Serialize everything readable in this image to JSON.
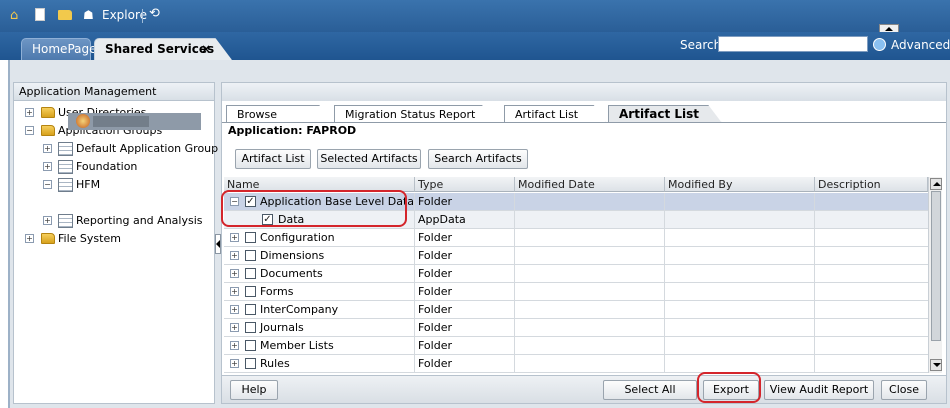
{
  "topbar": {
    "explore_label": "Explore"
  },
  "tabs": [
    {
      "label": "HomePage"
    },
    {
      "label": "Shared Services",
      "close": "×"
    }
  ],
  "search": {
    "label": "Search",
    "value": "",
    "advanced_label": "Advanced"
  },
  "left_panel": {
    "title": "Application Management",
    "tree": [
      {
        "label": "User Directories",
        "expander": "+"
      },
      {
        "label": "Application Groups",
        "expander": "−"
      },
      {
        "label": "Default Application Group",
        "expander": "+"
      },
      {
        "label": "Foundation",
        "expander": "+"
      },
      {
        "label": "HFM",
        "expander": "−"
      },
      {
        "label": "Reporting and Analysis",
        "expander": "+"
      },
      {
        "label": "File System",
        "expander": "+"
      }
    ]
  },
  "sub_tabs": [
    {
      "label": "Browse"
    },
    {
      "label": "Migration Status Report"
    },
    {
      "label": "Artifact List"
    },
    {
      "label": "Artifact List"
    }
  ],
  "application": {
    "label": "Application:",
    "name": "FAPROD"
  },
  "action_buttons": {
    "artifact_list": "Artifact List",
    "selected_artifacts": "Selected Artifacts",
    "search_artifacts": "Search Artifacts"
  },
  "grid": {
    "columns": [
      "Name",
      "Type",
      "Modified Date",
      "Modified By",
      "Description"
    ],
    "rows": [
      {
        "name": "Application Base Level Data",
        "type": "Folder",
        "checked": "✓",
        "expander": "−"
      },
      {
        "name": "Data",
        "type": "AppData",
        "checked": "✓",
        "expander": ""
      },
      {
        "name": "Configuration",
        "type": "Folder",
        "checked": "",
        "expander": "+"
      },
      {
        "name": "Dimensions",
        "type": "Folder",
        "checked": "",
        "expander": "+"
      },
      {
        "name": "Documents",
        "type": "Folder",
        "checked": "",
        "expander": "+"
      },
      {
        "name": "Forms",
        "type": "Folder",
        "checked": "",
        "expander": "+"
      },
      {
        "name": "InterCompany",
        "type": "Folder",
        "checked": "",
        "expander": "+"
      },
      {
        "name": "Journals",
        "type": "Folder",
        "checked": "",
        "expander": "+"
      },
      {
        "name": "Member Lists",
        "type": "Folder",
        "checked": "",
        "expander": "+"
      },
      {
        "name": "Rules",
        "type": "Folder",
        "checked": "",
        "expander": "+"
      }
    ]
  },
  "footer_buttons": {
    "help": "Help",
    "select_all": "Select All",
    "export": "Export",
    "view_audit_report": "View Audit Report",
    "close": "Close"
  },
  "colors": {
    "header_blue": "#2a5e97",
    "highlight_red": "#d4252b",
    "selected_row": "#c9d3e6"
  }
}
